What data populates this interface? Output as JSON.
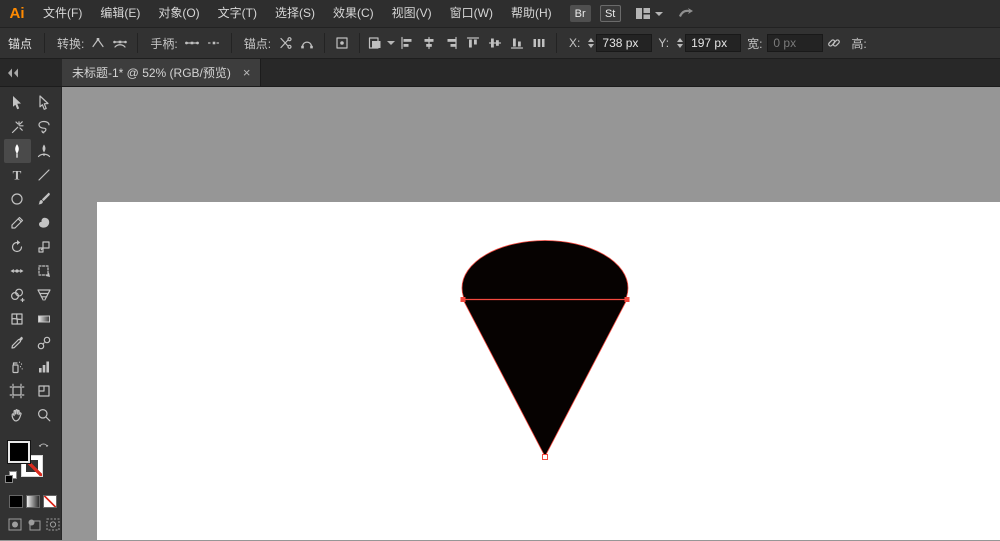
{
  "app": {
    "logo": "Ai"
  },
  "menubar": {
    "items": [
      "文件(F)",
      "编辑(E)",
      "对象(O)",
      "文字(T)",
      "选择(S)",
      "效果(C)",
      "视图(V)",
      "窗口(W)",
      "帮助(H)"
    ],
    "bridge_badge": "Br",
    "stock_badge": "St"
  },
  "controlbar": {
    "context_title": "锚点",
    "convert_label": "转换:",
    "handles_label": "手柄:",
    "anchors_label": "锚点:",
    "x_label": "X:",
    "x_value": "738 px",
    "y_label": "Y:",
    "y_value": "197 px",
    "width_label": "宽:",
    "width_value": "0 px",
    "height_label": "高:"
  },
  "tabbar": {
    "tab_title": "未标题-1* @ 52% (RGB/预览)",
    "close_glyph": "×"
  },
  "toolbar": {
    "selected_tool": "pen",
    "tools": [
      "selection",
      "direct-selection",
      "magic-wand",
      "lasso",
      "pen",
      "curvature",
      "type",
      "line-segment",
      "ellipse",
      "paintbrush",
      "pencil",
      "blob-brush",
      "rotate",
      "scale",
      "width",
      "free-transform",
      "shape-builder",
      "perspective-grid",
      "mesh",
      "gradient",
      "eyedropper",
      "blend",
      "symbol-sprayer",
      "column-graph",
      "artboard",
      "slice",
      "hand",
      "zoom"
    ]
  },
  "canvas": {
    "background": "#969696",
    "artboard_color": "#ffffff",
    "shape_fill": "#000000",
    "selection_color": "#f4493f",
    "shape": "cone shape (ellipse joined to triangle), path selected with anchor points visible"
  }
}
